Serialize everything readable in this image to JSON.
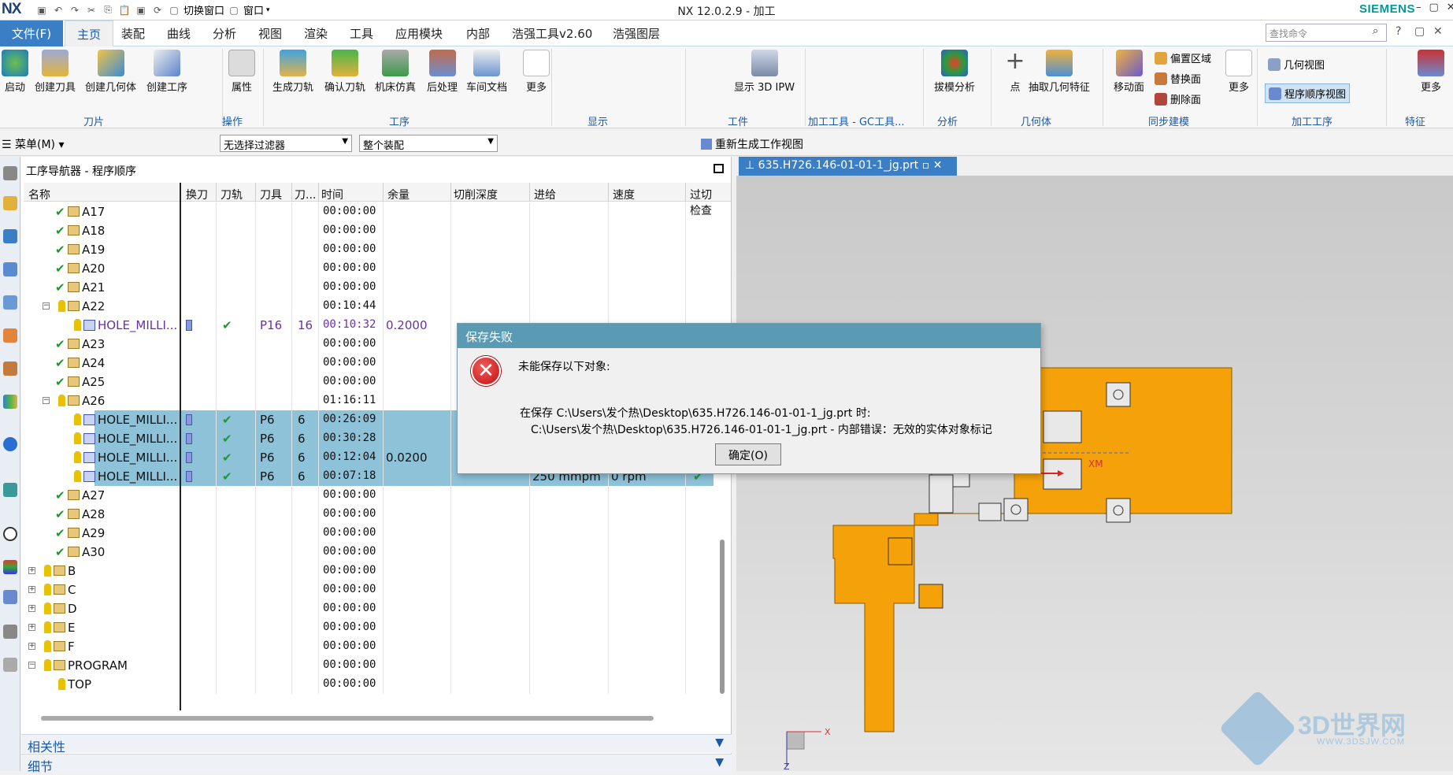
{
  "app": {
    "logo": "NX",
    "title": "NX 12.0.2.9 - 加工",
    "brand": "SIEMENS",
    "quick_access": {
      "switch_window": "切换窗口",
      "window": "窗口"
    }
  },
  "menu_tabs": [
    {
      "label": "文件(F)"
    },
    {
      "label": "主页"
    },
    {
      "label": "装配"
    },
    {
      "label": "曲线"
    },
    {
      "label": "分析"
    },
    {
      "label": "视图"
    },
    {
      "label": "渲染"
    },
    {
      "label": "工具"
    },
    {
      "label": "应用模块"
    },
    {
      "label": "内部"
    },
    {
      "label": "浩强工具v2.60"
    },
    {
      "label": "浩强图层"
    }
  ],
  "search": {
    "placeholder": "查找命令"
  },
  "ribbon": {
    "buttons": {
      "start": "启动",
      "create_tool": "创建刀具",
      "create_geometry": "创建几何体",
      "create_operation": "创建工序",
      "properties": "属性",
      "generate_path": "生成刀轨",
      "verify_path": "确认刀轨",
      "machine_sim": "机床仿真",
      "postprocess": "后处理",
      "shop_doc": "车间文档",
      "more": "更多",
      "show_3d_ipw": "显示 3D IPW",
      "draft_analysis": "拔模分析",
      "point": "点",
      "extract_geometry": "抽取几何特征",
      "move_face": "移动面",
      "more2": "更多",
      "offset_region": "偏置区域",
      "replace_face": "替换面",
      "delete_face": "删除面",
      "geometry_view": "几何视图",
      "program_order_view": "程序顺序视图",
      "more3": "更多"
    },
    "groups": {
      "tool": "刀片",
      "operations": "操作",
      "process": "工序",
      "display": "显示",
      "workpiece": "工件",
      "gc_tools": "加工工具 - GC工具...",
      "analysis": "分析",
      "geometry": "几何体",
      "sync_model": "同步建模",
      "machining_ops": "加工工序",
      "feature": "特征"
    }
  },
  "toolbar2": {
    "menu": "菜单(M)",
    "filter": "无选择过滤器",
    "assembly": "整个装配",
    "regen_view": "重新生成工作视图"
  },
  "navigator": {
    "title": "工序导航器 - 程序顺序",
    "columns": [
      "名称",
      "换刀",
      "刀轨",
      "刀具",
      "刀...",
      "时间",
      "余量",
      "切削深度",
      "进给",
      "速度",
      "过切检查"
    ],
    "rows": [
      {
        "name": "A17",
        "time": "00:00:00",
        "kind": "folder"
      },
      {
        "name": "A18",
        "time": "00:00:00",
        "kind": "folder"
      },
      {
        "name": "A19",
        "time": "00:00:00",
        "kind": "folder"
      },
      {
        "name": "A20",
        "time": "00:00:00",
        "kind": "folder"
      },
      {
        "name": "A21",
        "time": "00:00:00",
        "kind": "folder"
      },
      {
        "name": "A22",
        "time": "00:10:44",
        "kind": "folder-open"
      },
      {
        "name": "HOLE_MILLI...",
        "tool": "P16",
        "num": "16",
        "time": "00:10:32",
        "stock": "0.2000",
        "kind": "op-purple"
      },
      {
        "name": "A23",
        "time": "00:00:00",
        "kind": "folder"
      },
      {
        "name": "A24",
        "time": "00:00:00",
        "kind": "folder"
      },
      {
        "name": "A25",
        "time": "00:00:00",
        "kind": "folder"
      },
      {
        "name": "A26",
        "time": "01:16:11",
        "kind": "folder-open"
      },
      {
        "name": "HOLE_MILLI...",
        "tool": "P6",
        "num": "6",
        "time": "00:26:09",
        "kind": "op-sel"
      },
      {
        "name": "HOLE_MILLI...",
        "tool": "P6",
        "num": "6",
        "time": "00:30:28",
        "kind": "op-sel"
      },
      {
        "name": "HOLE_MILLI...",
        "tool": "P6",
        "num": "6",
        "time": "00:12:04",
        "stock": "0.0200",
        "kind": "op-sel"
      },
      {
        "name": "HOLE_MILLI...",
        "tool": "P6",
        "num": "6",
        "time": "00:07:18",
        "feed": "250 mmpm",
        "speed": "0 rpm",
        "kind": "op-sel"
      },
      {
        "name": "A27",
        "time": "00:00:00",
        "kind": "folder"
      },
      {
        "name": "A28",
        "time": "00:00:00",
        "kind": "folder"
      },
      {
        "name": "A29",
        "time": "00:00:00",
        "kind": "folder"
      },
      {
        "name": "A30",
        "time": "00:00:00",
        "kind": "folder"
      },
      {
        "name": "B",
        "time": "00:00:00",
        "kind": "group"
      },
      {
        "name": "C",
        "time": "00:00:00",
        "kind": "group"
      },
      {
        "name": "D",
        "time": "00:00:00",
        "kind": "group"
      },
      {
        "name": "E",
        "time": "00:00:00",
        "kind": "group"
      },
      {
        "name": "F",
        "time": "00:00:00",
        "kind": "group"
      },
      {
        "name": "PROGRAM",
        "time": "00:00:00",
        "kind": "program"
      },
      {
        "name": "TOP",
        "time": "00:00:00",
        "kind": "top"
      }
    ],
    "bottom_panels": {
      "dependencies": "相关性",
      "details": "细节"
    }
  },
  "graphics": {
    "tab": "635.H726.146-01-01-1_jg.prt",
    "axis_x": "XM",
    "triad_x": "X",
    "triad_z": "Z",
    "part_color": "#f5a20a"
  },
  "dialog": {
    "title": "保存失败",
    "heading": "未能保存以下对象:",
    "line1": "在保存 C:\\Users\\发个热\\Desktop\\635.H726.146-01-01-1_jg.prt 时:",
    "line2": "C:\\Users\\发个热\\Desktop\\635.H726.146-01-01-1_jg.prt - 内部错误：无效的实体对象标记",
    "ok": "确定(O)"
  },
  "watermark": {
    "text": "3D世界网",
    "url": "WWW.3DSJW.COM"
  }
}
